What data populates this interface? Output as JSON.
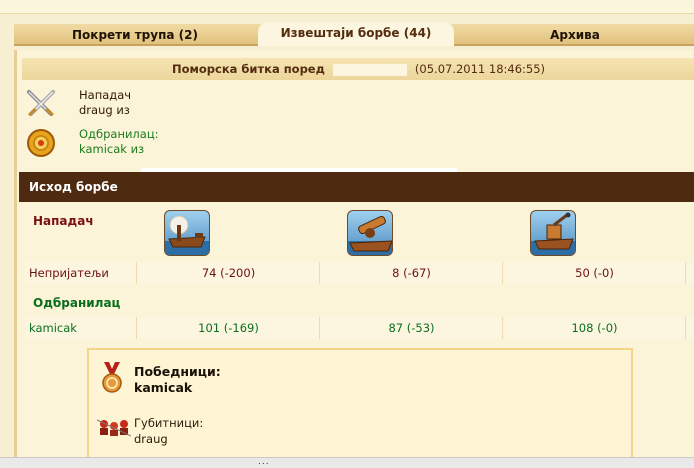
{
  "tabs": [
    {
      "label": "Покрети трупа (2)"
    },
    {
      "label": "Извештаји борбе (44)"
    },
    {
      "label": "Архива"
    }
  ],
  "report": {
    "title": "Поморска битка поред",
    "date": "(05.07.2011 18:46:55)",
    "attacker_label": "Нападач",
    "attacker_name": "draug из",
    "defender_label": "Одбранилац:",
    "defender_name": "kamicak из"
  },
  "result": {
    "header": "Исход борбе",
    "attacker_section": "Нападач",
    "defender_section": "Одбранилац",
    "units": [
      {
        "icon": "ram-ship-icon"
      },
      {
        "icon": "ballista-ship-icon"
      },
      {
        "icon": "catapult-ship-icon"
      }
    ],
    "rows": {
      "attacker": {
        "name": "Непријатељи",
        "values": [
          "74 (-200)",
          "8 (-67)",
          "50 (-0)"
        ]
      },
      "defender": {
        "name": "kamicak",
        "values": [
          "101 (-169)",
          "87 (-53)",
          "108 (-0)"
        ]
      }
    }
  },
  "outcome": {
    "winners_title": "Победници:",
    "winners_name": "kamicak",
    "losers_title": "Губитници:",
    "losers_name": "draug"
  },
  "scrollbar": {
    "grip": "..."
  }
}
